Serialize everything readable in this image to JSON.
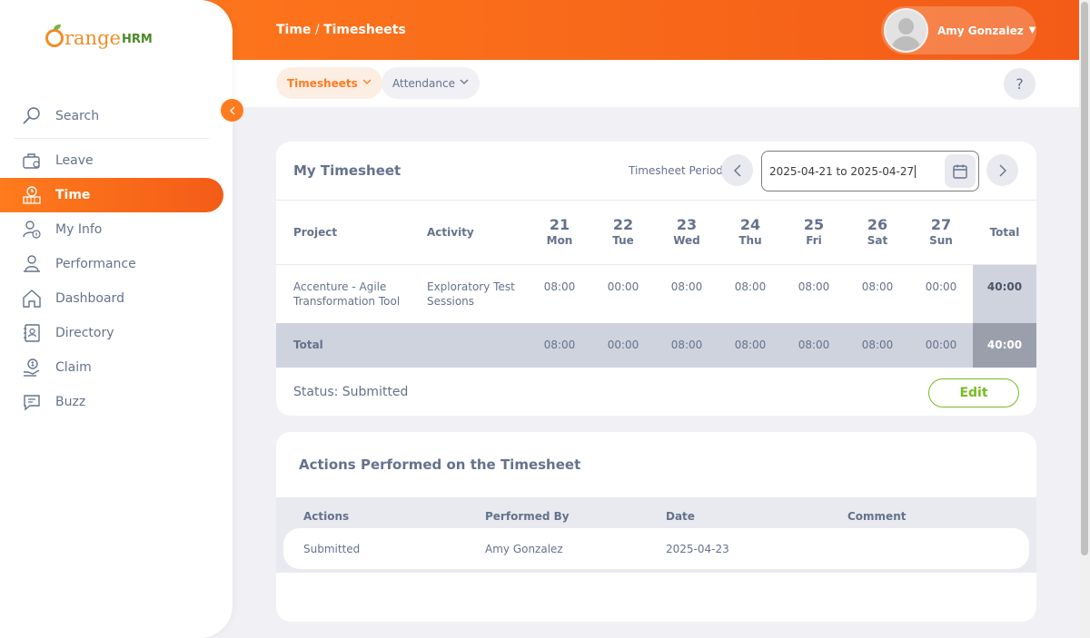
{
  "brand": {
    "logo_range": "range",
    "logo_hrm": "HRM"
  },
  "sidebar": {
    "search_label": "Search",
    "items": [
      {
        "label": "Leave",
        "icon": "leave-icon"
      },
      {
        "label": "Time",
        "icon": "time-icon",
        "active": true
      },
      {
        "label": "My Info",
        "icon": "my-info-icon"
      },
      {
        "label": "Performance",
        "icon": "performance-icon"
      },
      {
        "label": "Dashboard",
        "icon": "dashboard-icon"
      },
      {
        "label": "Directory",
        "icon": "directory-icon"
      },
      {
        "label": "Claim",
        "icon": "claim-icon"
      },
      {
        "label": "Buzz",
        "icon": "buzz-icon"
      }
    ]
  },
  "topbar": {
    "module": "Time",
    "separator": " / ",
    "page": "Timesheets",
    "user_name": "Amy Gonzalez"
  },
  "subnav": {
    "tab_timesheets": "Timesheets",
    "tab_attendance": "Attendance",
    "help": "?"
  },
  "timesheet": {
    "title": "My Timesheet",
    "period_label": "Timesheet Period",
    "period_value": "2025-04-21 to 2025-04-27",
    "headers": {
      "project": "Project",
      "activity": "Activity",
      "total": "Total"
    },
    "days": [
      {
        "num": "21",
        "name": "Mon"
      },
      {
        "num": "22",
        "name": "Tue"
      },
      {
        "num": "23",
        "name": "Wed"
      },
      {
        "num": "24",
        "name": "Thu"
      },
      {
        "num": "25",
        "name": "Fri"
      },
      {
        "num": "26",
        "name": "Sat"
      },
      {
        "num": "27",
        "name": "Sun"
      }
    ],
    "row": {
      "project_line1": "Accenture - Agile",
      "project_line2": "Transformation Tool",
      "activity_line1": "Exploratory Test",
      "activity_line2": "Sessions",
      "hours": [
        "08:00",
        "00:00",
        "08:00",
        "08:00",
        "08:00",
        "08:00",
        "00:00"
      ],
      "total": "40:00"
    },
    "totals": {
      "label": "Total",
      "hours": [
        "08:00",
        "00:00",
        "08:00",
        "08:00",
        "08:00",
        "08:00",
        "00:00"
      ],
      "total": "40:00"
    },
    "status": "Status: Submitted",
    "edit_label": "Edit"
  },
  "actions": {
    "title": "Actions Performed on the Timesheet",
    "headers": {
      "actions": "Actions",
      "performed_by": "Performed By",
      "date": "Date",
      "comment": "Comment"
    },
    "row": {
      "action": "Submitted",
      "performed_by": "Amy Gonzalez",
      "date": "2025-04-23",
      "comment": ""
    }
  },
  "colors": {
    "accent": "#ff7b1d",
    "edit_green": "#76bc21",
    "text": "#64728c"
  }
}
